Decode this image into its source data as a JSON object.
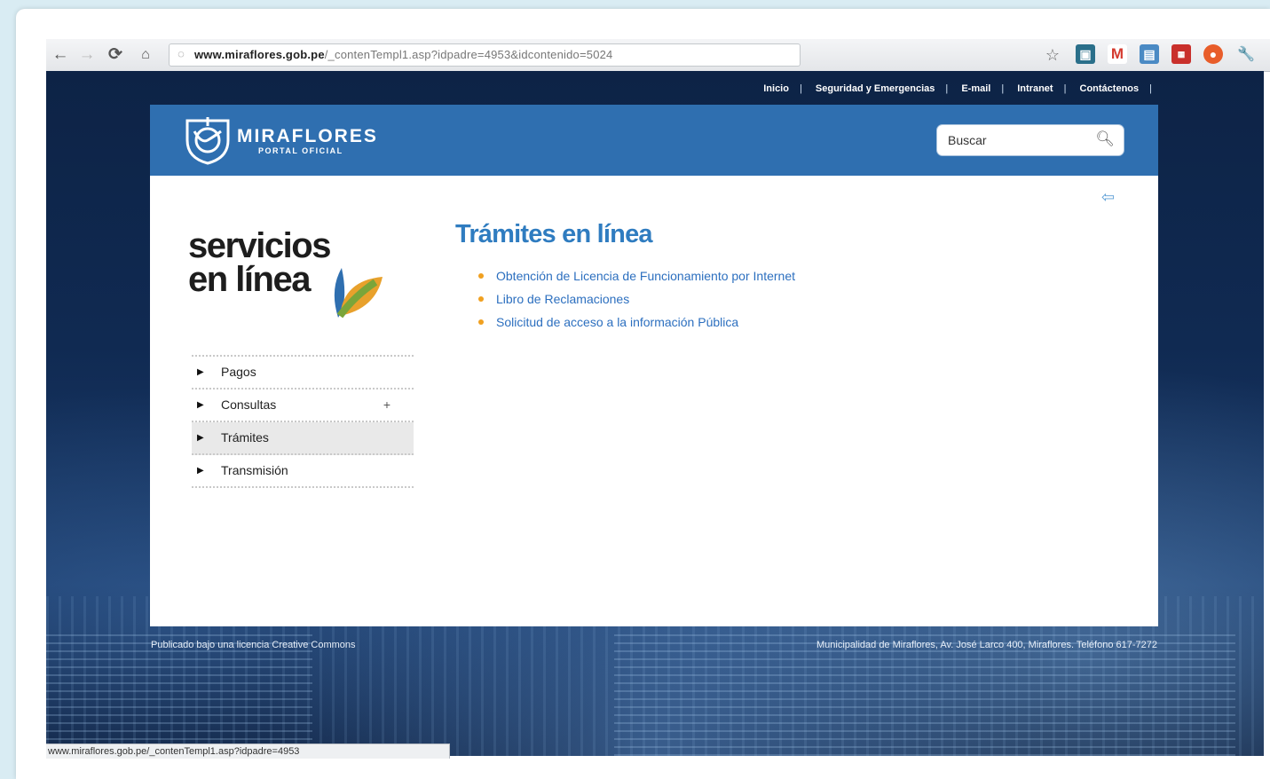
{
  "browser": {
    "url_host": "www.miraflores.gob.pe",
    "url_path": "/_contenTempl1.asp?idpadre=4953&idcontenido=5024",
    "status_url": "www.miraflores.gob.pe/_contenTempl1.asp?idpadre=4953",
    "icons": [
      "back-icon",
      "forward-icon",
      "reload-icon",
      "home-icon",
      "globe-icon",
      "star-icon",
      "gmail-icon",
      "wrench-icon"
    ]
  },
  "topnav": {
    "items": [
      "Inicio",
      "Seguridad y Emergencias",
      "E-mail",
      "Intranet",
      "Contáctenos"
    ],
    "separator": "|"
  },
  "header": {
    "brand": "MIRAFLORES",
    "brand_sub": "PORTAL OFICIAL",
    "search_placeholder": "Buscar"
  },
  "sidebar": {
    "title_line1": "servicios",
    "title_line2": "en línea",
    "menu": [
      {
        "label": "Pagos"
      },
      {
        "label": "Consultas",
        "expand": "+"
      },
      {
        "label": "Trámites",
        "active": true
      },
      {
        "label": "Transmisión"
      }
    ]
  },
  "main": {
    "title": "Trámites en línea",
    "links": [
      "Obtención de Licencia de Funcionamiento por Internet",
      "Libro de Reclamaciones",
      "Solicitud de acceso a la información Pública"
    ]
  },
  "footer": {
    "left": "Publicado bajo una licencia Creative Commons",
    "right": "Municipalidad de Miraflores, Av. José Larco 400, Miraflores. Teléfono 617-7272"
  },
  "colors": {
    "header_blue": "#2f6fb0",
    "link_blue": "#2c6fbf",
    "title_blue": "#2f7cc0",
    "bullet_orange": "#f0a020"
  }
}
